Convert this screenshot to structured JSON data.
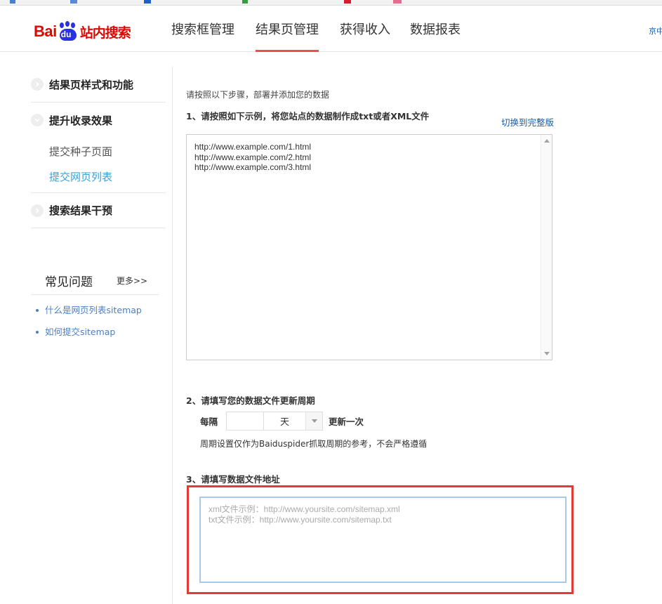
{
  "header": {
    "logo_text": "Bai",
    "logo_paw_text": "du",
    "logo_sub": "站内搜索",
    "nav": [
      {
        "label": "搜索框管理",
        "active": false
      },
      {
        "label": "结果页管理",
        "active": true
      },
      {
        "label": "获得收入",
        "active": false
      },
      {
        "label": "数据报表",
        "active": false
      }
    ],
    "right_text": "京中"
  },
  "sidebar": {
    "sections": [
      {
        "label": "结果页样式和功能",
        "icon": "chevron-right-icon"
      },
      {
        "label": "提升收录效果",
        "icon": "chevron-down-icon"
      },
      {
        "label": "搜索结果干预",
        "icon": "chevron-right-icon"
      }
    ],
    "sub_items": [
      {
        "label": "提交种子页面",
        "active": false
      },
      {
        "label": "提交网页列表",
        "active": true
      }
    ],
    "faq": {
      "title": "常见问题",
      "more": "更多>>",
      "links": [
        "什么是网页列表sitemap",
        "如何提交sitemap"
      ]
    }
  },
  "main": {
    "intro": "请按照以下步骤，部署并添加您的数据",
    "step1": "1、请按照如下示例，将您站点的数据制作成txt或者XML文件",
    "switch_link": "切换到完整版",
    "example_lines": [
      "http://www.example.com/1.html",
      "http://www.example.com/2.html",
      "http://www.example.com/3.html"
    ],
    "step2": "2、请填写您的数据文件更新周期",
    "freq": {
      "prefix": "每隔",
      "input_value": "",
      "unit": "天",
      "suffix": "更新一次",
      "note": "周期设置仅作为Baiduspider抓取周期的参考，不会严格遵循"
    },
    "step3": "3、请填写数据文件地址",
    "url_placeholder": "xml文件示例：http://www.yoursite.com/sitemap.xml\ntxt文件示例：http://www.yoursite.com/sitemap.txt",
    "url_value": ""
  },
  "colors": {
    "accent_red": "#e65050",
    "link_blue": "#1a5aa8",
    "active_sub": "#3aa2d6",
    "highlight_box": "#e53935"
  }
}
